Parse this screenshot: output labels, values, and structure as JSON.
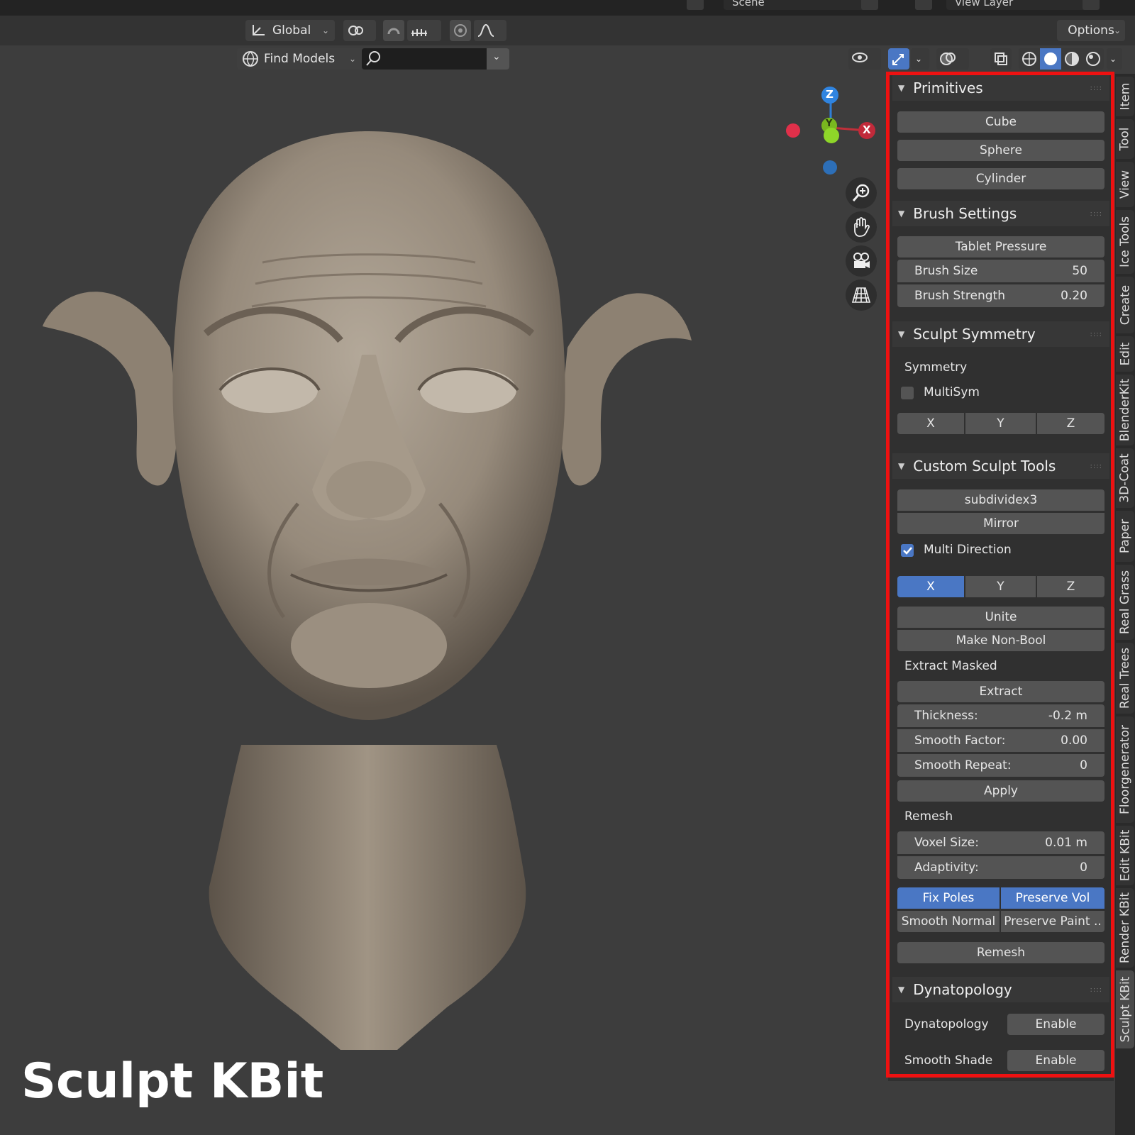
{
  "topbar": {
    "scene_label": "Scene",
    "view_layer_label": "View Layer"
  },
  "toolbar": {
    "orientation_label": "Global",
    "options_label": "Options",
    "find_models_label": "Find Models",
    "search_value": ""
  },
  "gizmo": {
    "z_label": "Z",
    "y_label": "Y",
    "x_label": "X"
  },
  "caption": "Sculpt KBit",
  "tabs": [
    "Item",
    "Tool",
    "View",
    "Ice Tools",
    "Create",
    "Edit",
    "BlenderKit",
    "3D-Coat",
    "Paper",
    "Real Grass",
    "Real Trees",
    "Floorgenerator",
    "Edit KBit",
    "Render KBit",
    "Sculpt KBit"
  ],
  "active_tab": "Sculpt KBit",
  "primitives": {
    "title": "Primitives",
    "buttons": [
      "Cube",
      "Sphere",
      "Cylinder"
    ]
  },
  "brush": {
    "title": "Brush Settings",
    "tablet_pressure": "Tablet Pressure",
    "size_label": "Brush Size",
    "size_value": "50",
    "strength_label": "Brush Strength",
    "strength_value": "0.20"
  },
  "symmetry": {
    "title": "Sculpt Symmetry",
    "heading": "Symmetry",
    "multisym_label": "MultiSym",
    "multisym_checked": false,
    "axes": [
      "X",
      "Y",
      "Z"
    ]
  },
  "custom": {
    "title": "Custom Sculpt Tools",
    "subdivide": "subdividex3",
    "mirror": "Mirror",
    "multi_direction_label": "Multi Direction",
    "multi_direction_checked": true,
    "axes": [
      "X",
      "Y",
      "Z"
    ],
    "active_axis": "X",
    "unite": "Unite",
    "make_non_bool": "Make Non-Bool",
    "extract_masked": "Extract Masked",
    "extract": "Extract",
    "thickness_label": "Thickness:",
    "thickness_value": "-0.2 m",
    "smooth_factor_label": "Smooth Factor:",
    "smooth_factor_value": "0.00",
    "smooth_repeat_label": "Smooth Repeat:",
    "smooth_repeat_value": "0",
    "apply": "Apply",
    "remesh_heading": "Remesh",
    "voxel_label": "Voxel Size:",
    "voxel_value": "0.01 m",
    "adaptivity_label": "Adaptivity:",
    "adaptivity_value": "0",
    "fix_poles": "Fix Poles",
    "preserve_vol": "Preserve Vol",
    "smooth_normal": "Smooth Normal",
    "preserve_paint": "Preserve Paint ..",
    "remesh_button": "Remesh"
  },
  "dyntopo": {
    "title": "Dynatopology",
    "row1_label": "Dynatopology",
    "row1_button": "Enable",
    "row2_label": "Smooth Shade",
    "row2_button": "Enable"
  },
  "colors": {
    "accent": "#4a77c4",
    "highlight_box": "#ee1111",
    "background": "#3d3d3d",
    "panel": "#303030",
    "button": "#545454"
  }
}
